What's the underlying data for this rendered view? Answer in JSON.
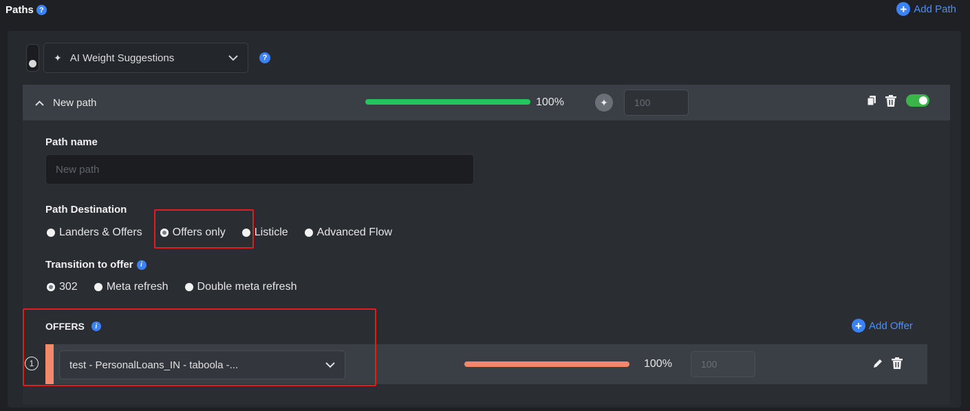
{
  "header": {
    "title": "Paths",
    "help": "?",
    "add_path_label": "Add Path"
  },
  "ai": {
    "label": "AI Weight Suggestions"
  },
  "path": {
    "name": "New path",
    "percent": "100%",
    "weight_placeholder": "100",
    "active": true
  },
  "form": {
    "path_name_label": "Path name",
    "path_name_placeholder": "New path",
    "destination_label": "Path Destination",
    "destinations": [
      {
        "label": "Landers & Offers",
        "selected": false
      },
      {
        "label": "Offers only",
        "selected": true
      },
      {
        "label": "Listicle",
        "selected": false
      },
      {
        "label": "Advanced Flow",
        "selected": false
      }
    ],
    "transition_label": "Transition to offer",
    "transitions": [
      {
        "label": "302",
        "selected": true
      },
      {
        "label": "Meta refresh",
        "selected": false
      },
      {
        "label": "Double meta refresh",
        "selected": false
      }
    ]
  },
  "offers": {
    "title": "OFFERS",
    "add_label": "Add Offer",
    "items": [
      {
        "index": "1",
        "name": "test - PersonalLoans_IN - taboola -...",
        "percent": "100%",
        "weight_placeholder": "100"
      }
    ]
  },
  "colors": {
    "accent_blue": "#3b82f6",
    "path_bar": "#22c55e",
    "offer_bar": "#f4876b",
    "highlight": "#e01e1e"
  }
}
